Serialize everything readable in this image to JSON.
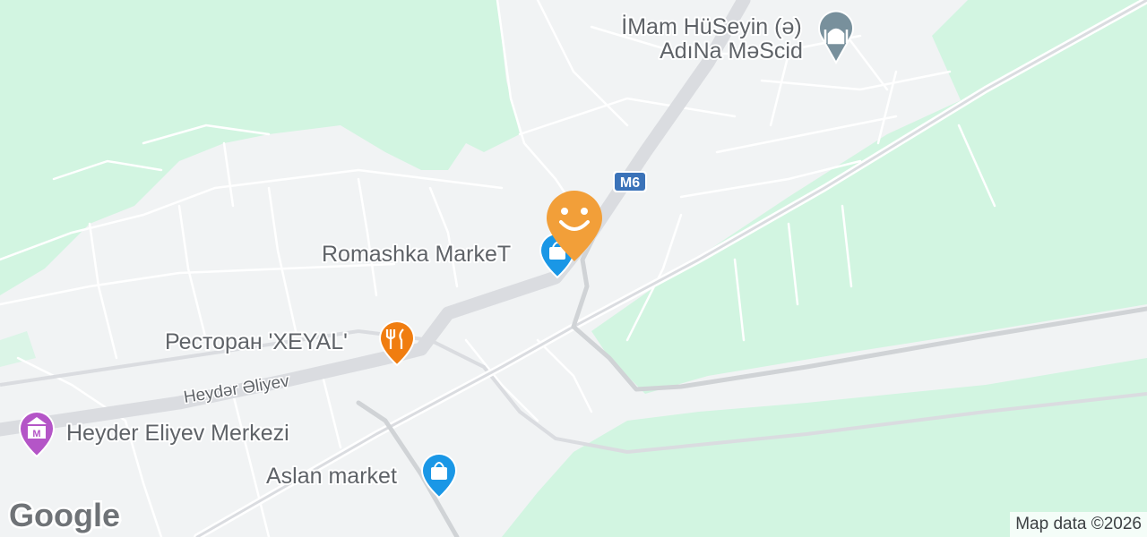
{
  "map": {
    "places": [
      {
        "name": "İMam HüSeyin (ə)",
        "name2": "AdıNa MəScid",
        "icon": "mosque-icon",
        "color": "#78909c"
      },
      {
        "name": "Romashka MarkeT",
        "icon": "shopping-bag-icon",
        "color": "#1a97e6"
      },
      {
        "name": "Ресторан 'XEYAL'",
        "icon": "fork-knife-icon",
        "color": "#f07d10"
      },
      {
        "name": "Heyder Eliyev Merkezi",
        "icon": "museum-icon",
        "color": "#b455c7"
      },
      {
        "name": "Aslan market",
        "icon": "shopping-bag-icon",
        "color": "#1a97e6"
      }
    ],
    "roads": [
      {
        "label": "Heydər Əliyev"
      }
    ],
    "shield": {
      "label": "M6",
      "color": "#3b73b9"
    },
    "user_marker": {
      "icon": "smiley-icon",
      "color": "#f29f39"
    },
    "brand": {
      "label": "Google"
    },
    "attribution": {
      "label": "Map data ©2026"
    }
  },
  "colors": {
    "land": "#f1f3f4",
    "park": "#d2f5e1",
    "road": "#ffffff",
    "highway": "#dadce0"
  }
}
